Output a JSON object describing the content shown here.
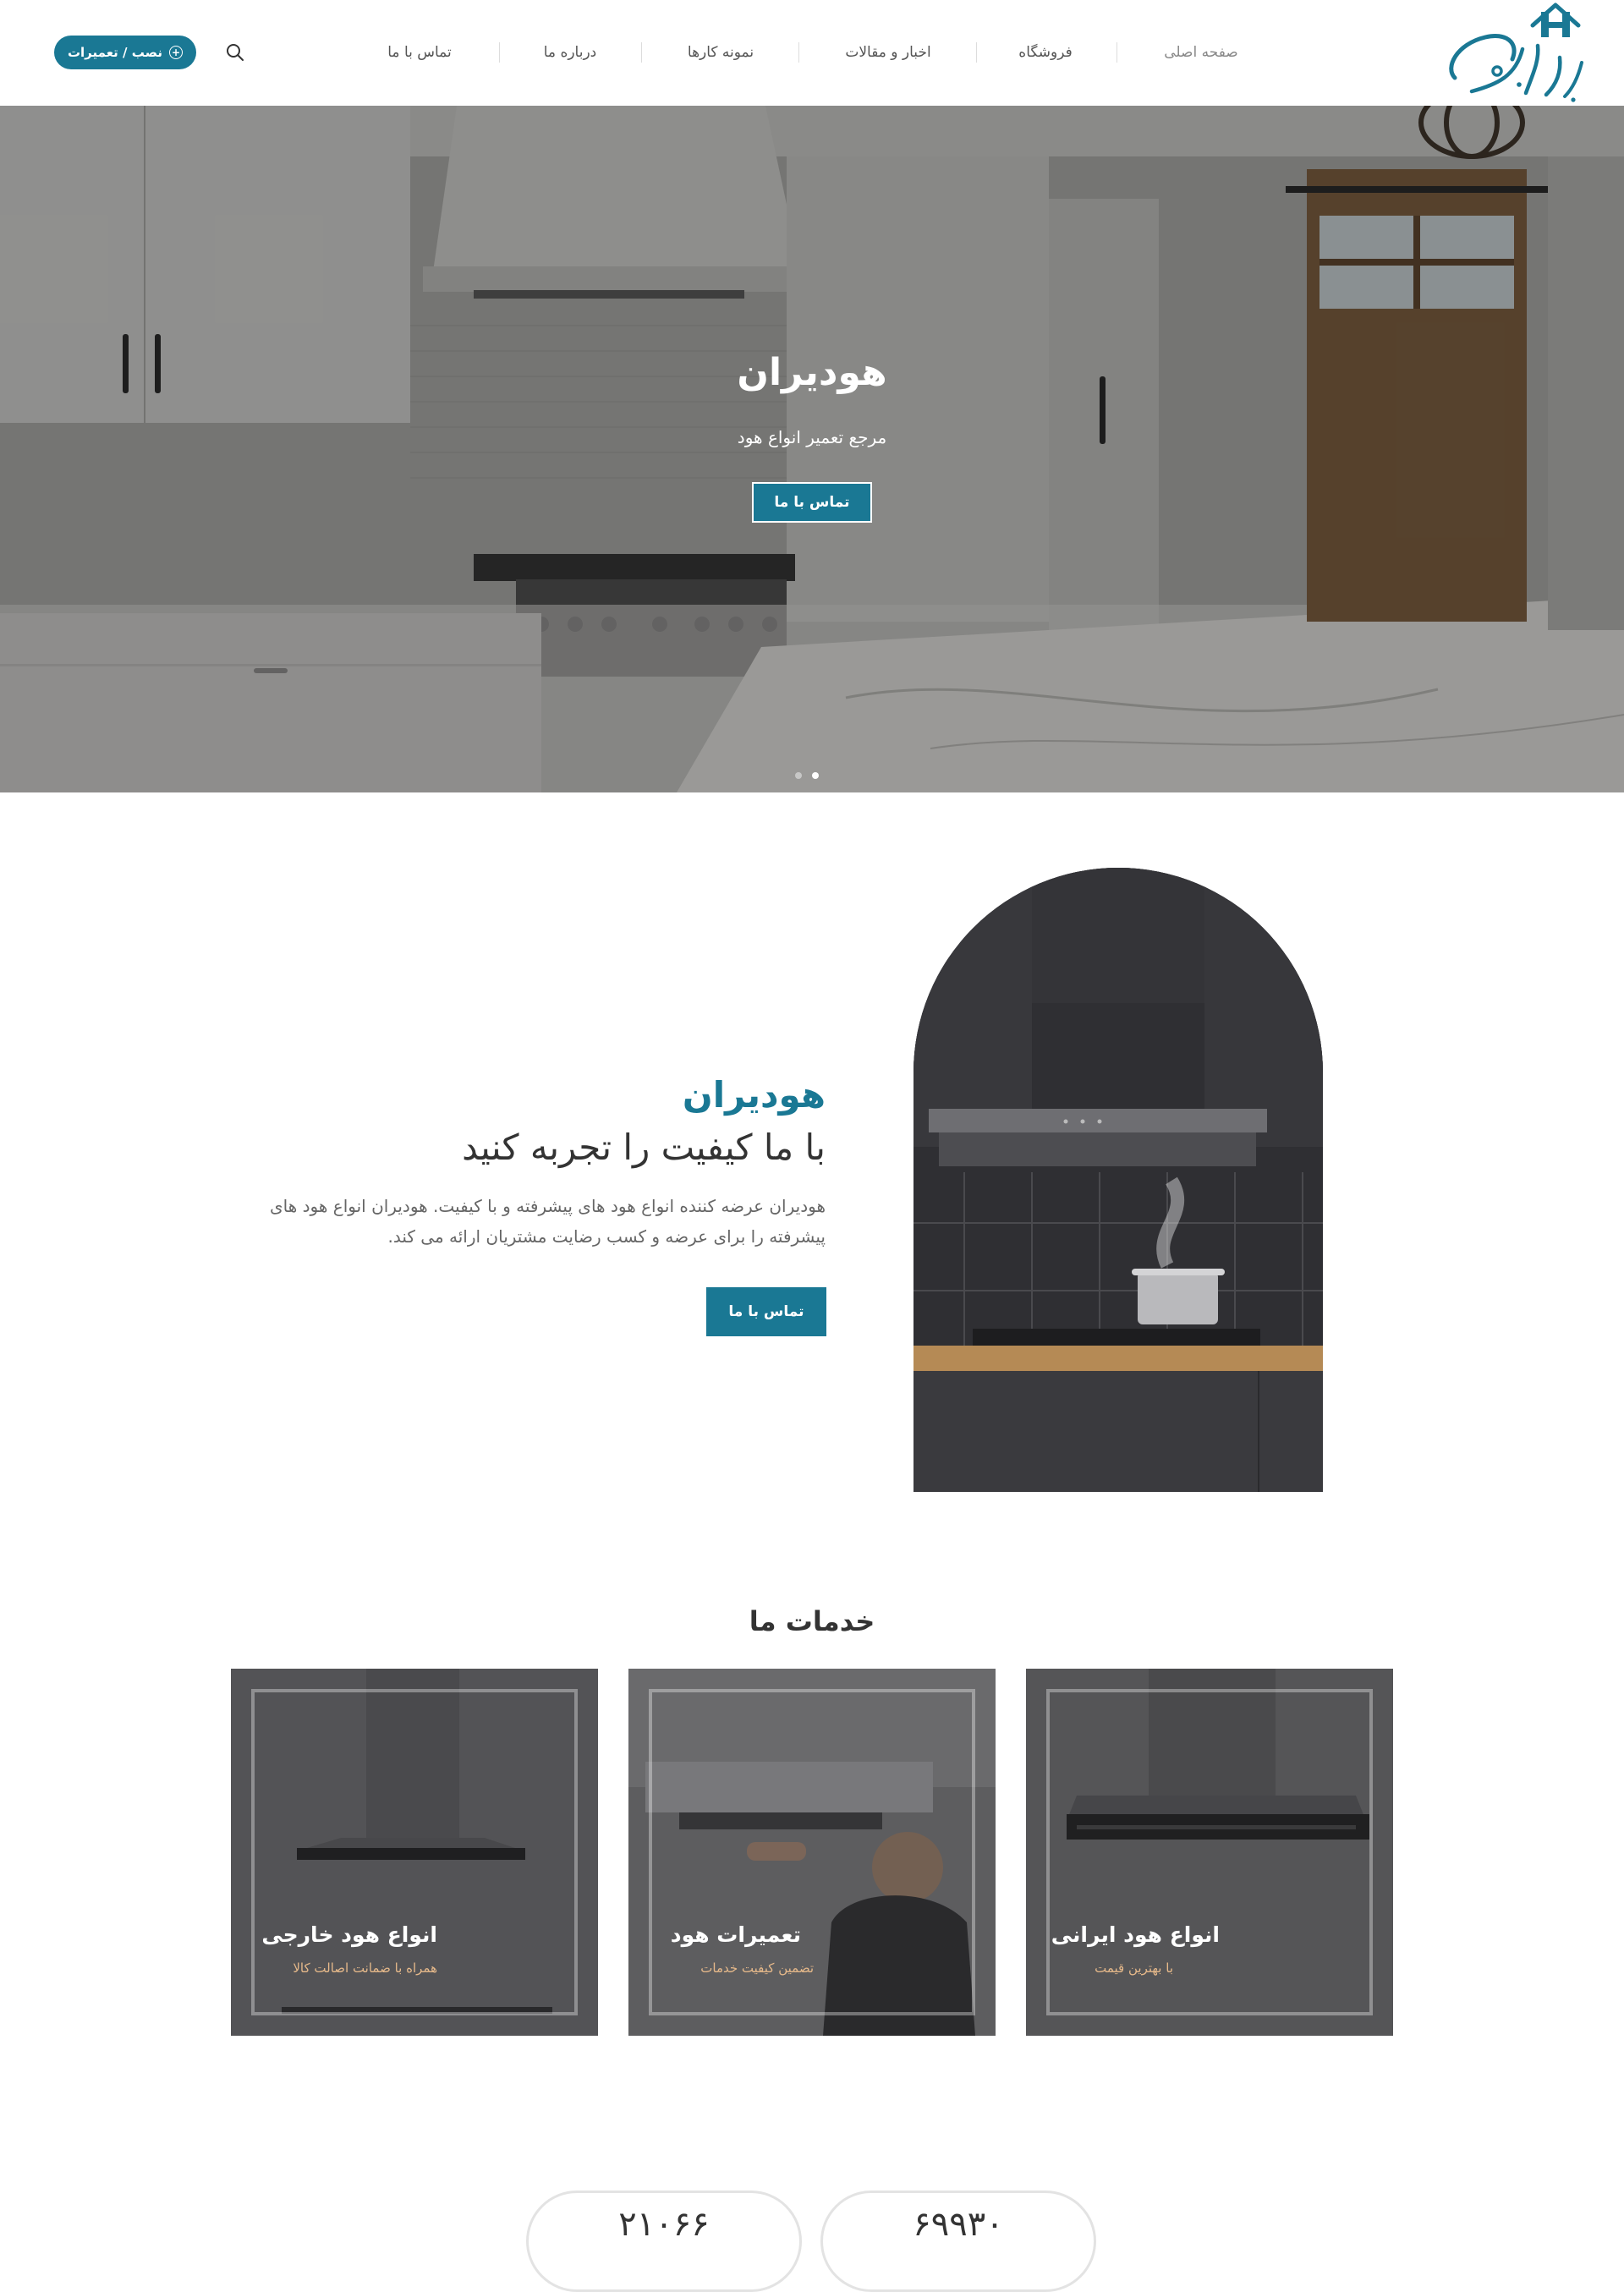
{
  "header": {
    "logo_text": "هودیران",
    "nav": [
      {
        "label": "صفحه اصلی",
        "active": true
      },
      {
        "label": "فروشگاه"
      },
      {
        "label": "اخبار و مقالات"
      },
      {
        "label": "نمونه کارها"
      },
      {
        "label": "درباره ما"
      },
      {
        "label": "تماس با ما"
      }
    ],
    "search_icon": "search-icon",
    "cta_label": "نصب / تعمیرات"
  },
  "hero": {
    "title": "هودیران",
    "subtitle": "مرجع تعمیر انواع هود",
    "button": "تماس با ما",
    "slides": 2,
    "active_slide": 2
  },
  "about": {
    "brand": "هودیران",
    "headline": "با ما کیفیت را تجربه کنید",
    "description": "هودیران عرضه کننده انواع هود های پیشرفته و با کیفیت. هودیران انواع هود های پیشرفته را برای عرضه و کسب رضایت مشتریان ارائه می کند.",
    "button": "تماس با ما"
  },
  "services": {
    "title": "خدمات ما",
    "cards": [
      {
        "title": "انواع هود ایرانی",
        "subtitle": "با بهترین قیمت"
      },
      {
        "title": "تعمیرات هود",
        "subtitle": "تضمین کیفیت خدمات"
      },
      {
        "title": "انواع هود خارجی",
        "subtitle": "همراه با ضمانت اصالت کالا"
      }
    ]
  },
  "stats": [
    {
      "value": "۶۹۹۳۰"
    },
    {
      "value": "۲۱۰۶۶"
    }
  ],
  "colors": {
    "accent": "#1a7894",
    "card_subtitle": "#e6b98a"
  }
}
